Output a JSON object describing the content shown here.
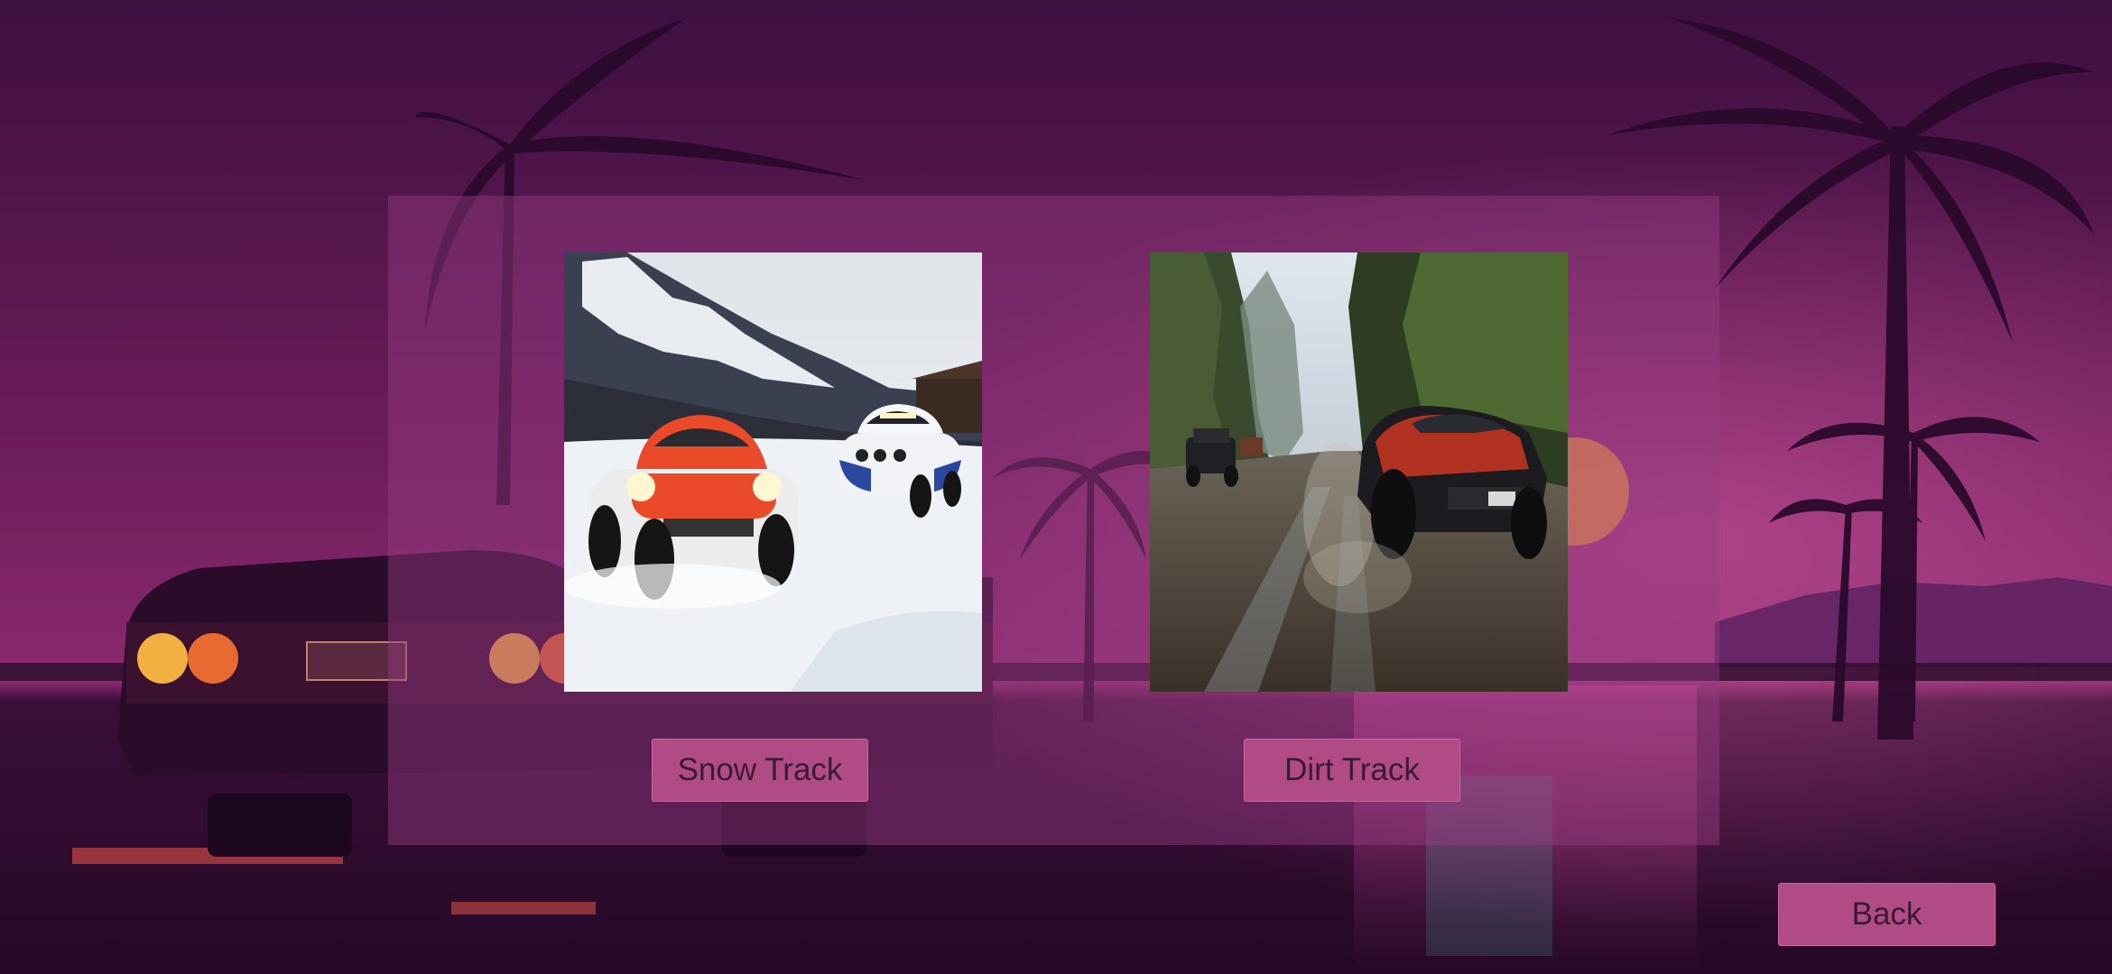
{
  "screen": "track-select",
  "tracks": [
    {
      "id": "snow",
      "image": "snow-rally-cars-image",
      "label": "Snow Track"
    },
    {
      "id": "dirt",
      "image": "mud-offroad-trucks-image",
      "label": "Dirt Track"
    }
  ],
  "buttons": {
    "back_label": "Back"
  },
  "background": {
    "image": "synthwave-palm-beach-sunset-with-classic-car",
    "colors": {
      "sky_top": "#3d1040",
      "sky_mid": "#6e1e5c",
      "ground": "#2a0a2c",
      "sun": "#f2a040"
    }
  },
  "colors": {
    "button": "#b04b86",
    "button_text": "#3b1a35",
    "panel": "rgba(150,60,130,0.45)"
  }
}
